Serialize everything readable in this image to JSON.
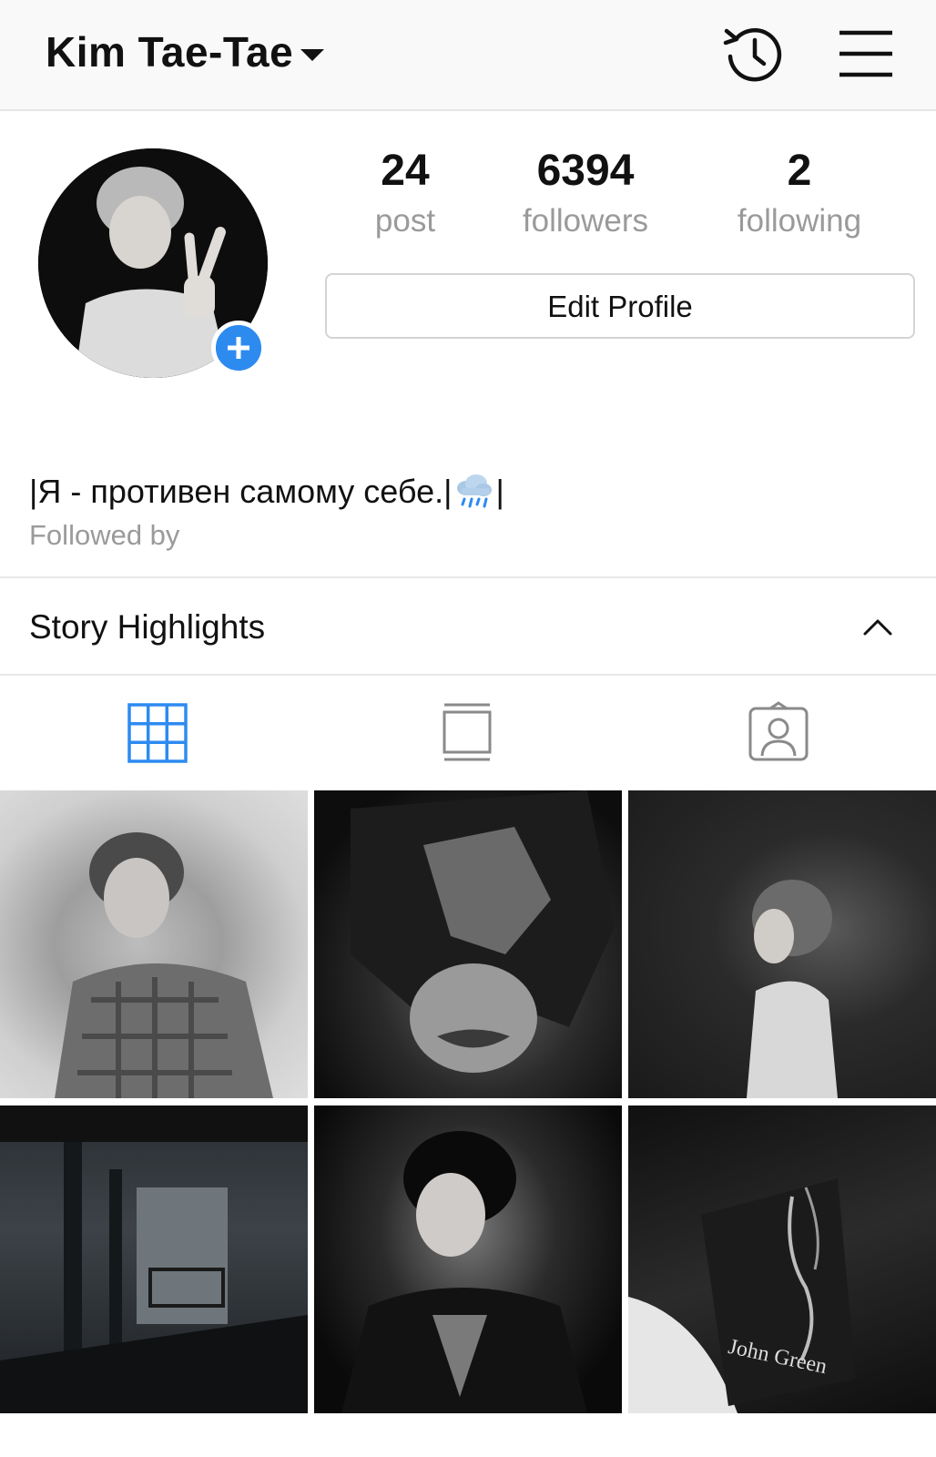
{
  "header": {
    "username": "Kim Tae-Tae",
    "icons": [
      "chevron-down-icon",
      "history-icon",
      "menu-icon"
    ]
  },
  "profile": {
    "stats": {
      "posts": {
        "value": "24",
        "label": "post"
      },
      "followers": {
        "value": "6394",
        "label": "followers"
      },
      "following": {
        "value": "2",
        "label": "following"
      }
    },
    "edit_button": "Edit Profile",
    "bio_before": "|Я - противен самому себе.|",
    "bio_after": "|",
    "followed_by": "Followed by"
  },
  "highlights": {
    "title": "Story Highlights"
  },
  "tabs": {
    "active": "grid",
    "items": [
      "grid-icon",
      "feed-icon",
      "tagged-icon"
    ]
  },
  "colors": {
    "accent": "#2d8bf0",
    "muted_text": "#9a9a9a",
    "header_bg": "#f9f9fa"
  },
  "posts": {
    "count_shown": 6,
    "book_title": "John Green"
  }
}
